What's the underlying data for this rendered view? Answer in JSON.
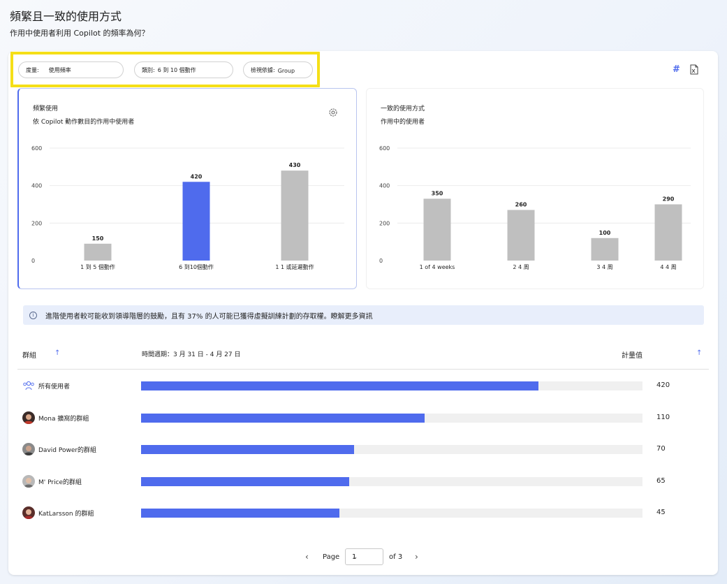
{
  "page": {
    "title": "頻繁且一致的使用方式",
    "subtitle": "作用中使用者利用 Copilot 的頻率為何？"
  },
  "filters": {
    "metric_key": "度量:",
    "metric_value": "使用頻率",
    "category_key": "類別:",
    "category_value": "6 到 10 個動作",
    "viewby_key": "檢視依據:",
    "viewby_value": "Group"
  },
  "toolbar": {
    "hash_icon": "#",
    "export_icon": "export-excel-icon"
  },
  "colors": {
    "accent": "#4f6bed",
    "neutral_bar": "#bfbfbf",
    "highlight": "#f5df18"
  },
  "chart_left": {
    "title": "頻繁使用",
    "subtitle": "依 Copilot 動作數目的作用中使用者"
  },
  "chart_right": {
    "title": "一致的使用方式",
    "subtitle": "作用中的使用者"
  },
  "chart_data": [
    {
      "type": "bar",
      "categories": [
        "1 到 5 個動作",
        "6 到10個動作",
        "1 1 或延遲動作"
      ],
      "values": [
        150,
        420,
        430
      ],
      "bar_values_drawn": [
        90,
        420,
        480
      ],
      "highlight_index": 1,
      "ylim": [
        0,
        600
      ],
      "yticks": [
        0,
        200,
        400,
        600
      ],
      "grid": true
    },
    {
      "type": "bar",
      "categories": [
        "1 of 4 weeks",
        "2 4 周",
        "3 4 周",
        "4 4 周"
      ],
      "values": [
        350,
        260,
        100,
        290
      ],
      "bar_values_drawn": [
        330,
        270,
        120,
        300
      ],
      "highlight_index": -1,
      "ylim": [
        0,
        600
      ],
      "yticks": [
        0,
        200,
        400,
        600
      ],
      "grid": true
    }
  ],
  "info": {
    "text": "進階使用者較可能收到領導階層的鼓勵，且有 37% 的人可能已獲得虛擬訓練計劃的存取權。瞭解更多資訊"
  },
  "table": {
    "col_group": "群組",
    "col_period": "時間週期：3 月 31 日 - 4 月 27 日",
    "col_metric": "計量值",
    "scale_max": 530,
    "rows": [
      {
        "label": "所有使用者",
        "value": 420,
        "avatar": "group-icon"
      },
      {
        "label": "Mona 擴窩的群組",
        "value": 110,
        "bar_value": 300
      },
      {
        "label": "David Power的群組",
        "value": 70,
        "bar_value": 225
      },
      {
        "label": "M' Price的群組",
        "value": 65,
        "bar_value": 220
      },
      {
        "label": "KatLarsson 的群組",
        "value": 45,
        "bar_value": 210
      }
    ]
  },
  "pager": {
    "page_label": "Page",
    "current": "1",
    "of_label": "of 3"
  }
}
